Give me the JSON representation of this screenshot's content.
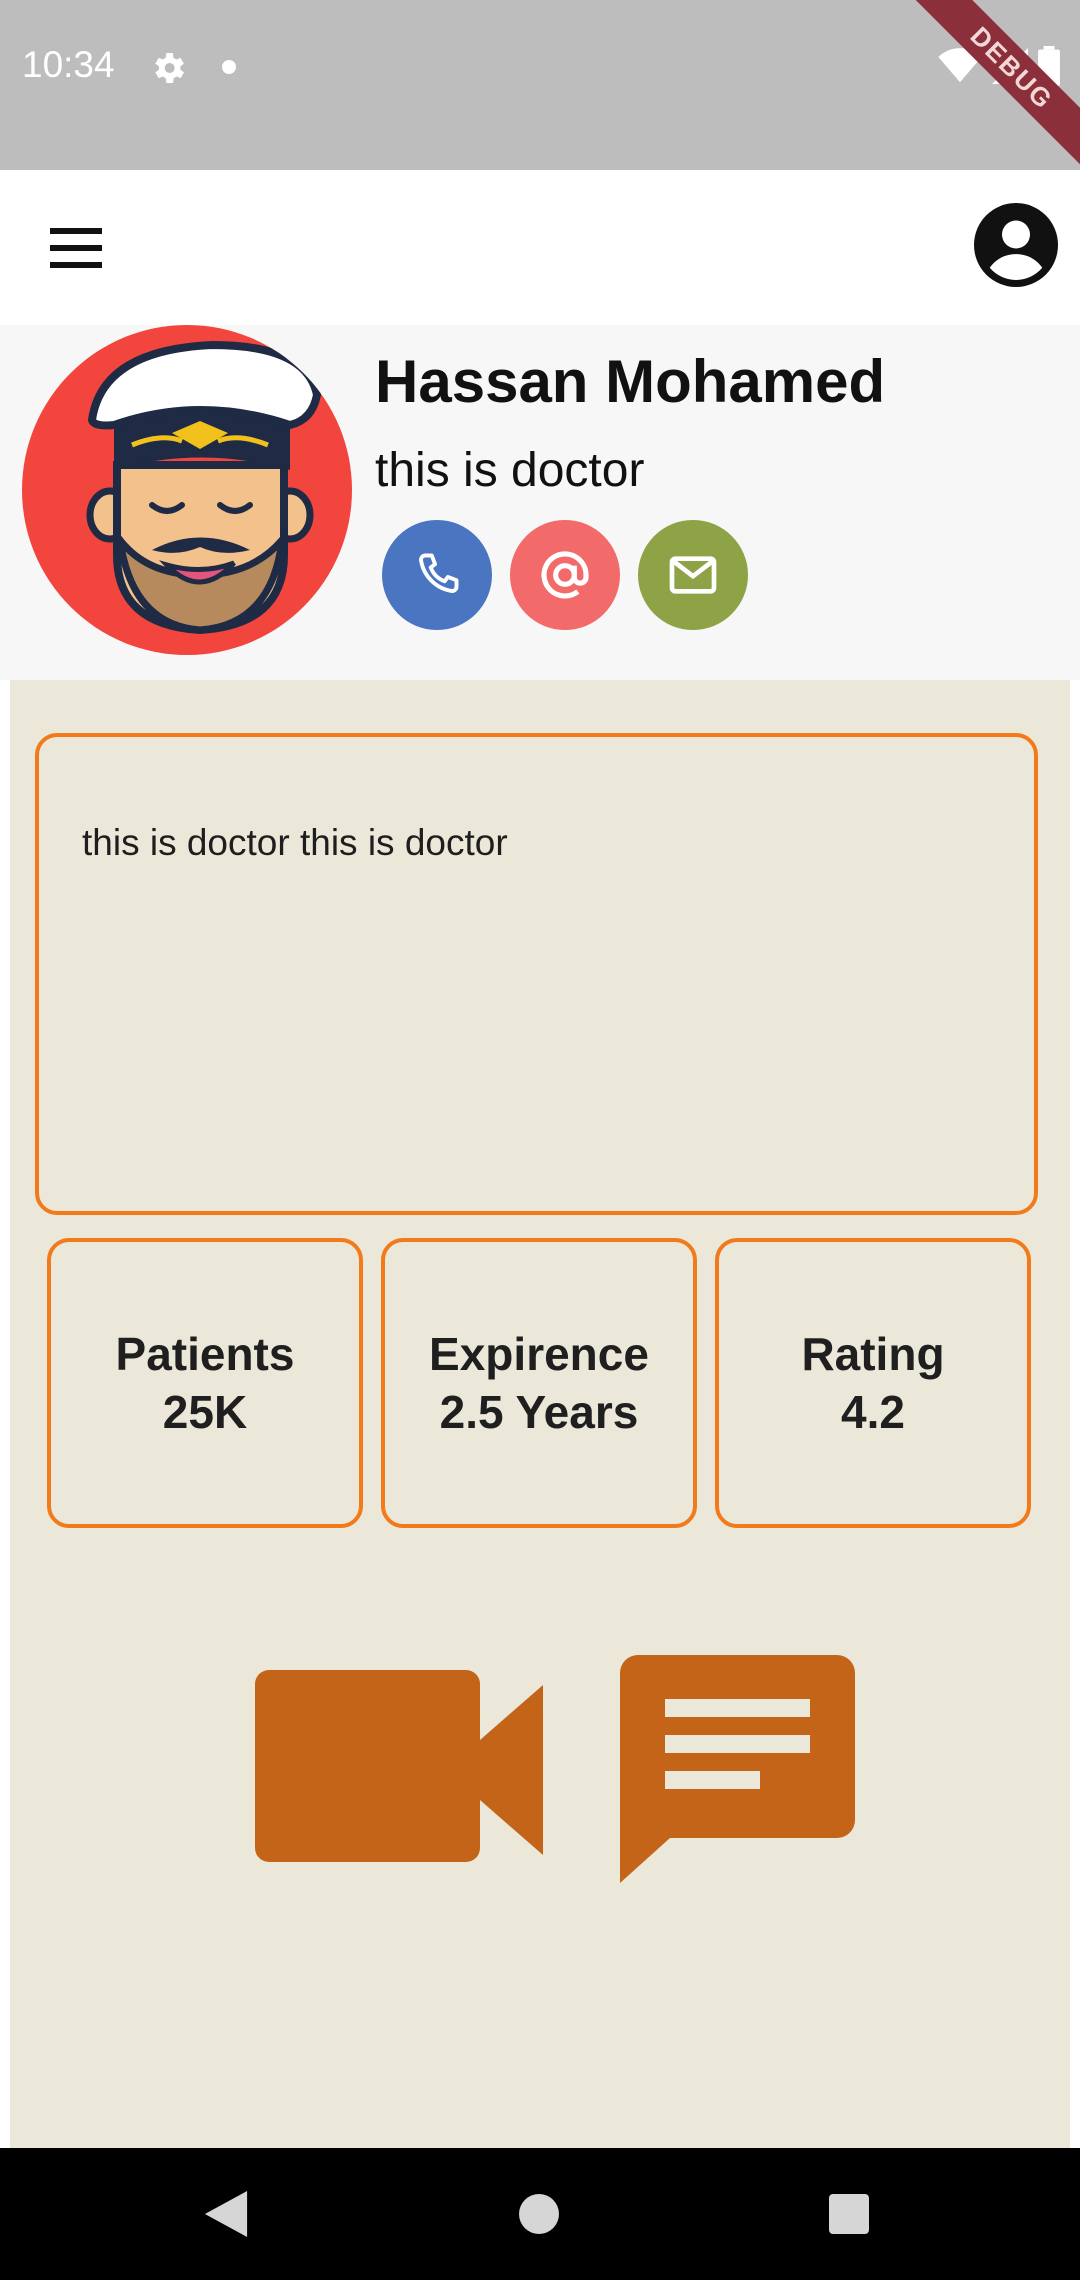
{
  "status_bar": {
    "time": "10:34",
    "icons": [
      "gear-icon",
      "notification-dot-icon",
      "wifi-icon",
      "signal-icon",
      "battery-icon"
    ],
    "debug_banner": "DEBUG"
  },
  "app_bar": {
    "icons": [
      "menu-icon",
      "account-icon"
    ]
  },
  "profile": {
    "name": "Hassan Mohamed",
    "subtitle": "this is doctor",
    "contact_buttons": [
      {
        "icon": "phone-icon",
        "color": "#4a76c1"
      },
      {
        "icon": "at-sign-icon",
        "color": "#f26a6a"
      },
      {
        "icon": "mail-icon",
        "color": "#8ea345"
      }
    ]
  },
  "about": {
    "text": "this is doctor this is doctor"
  },
  "stats": [
    {
      "label": "Patients",
      "value": "25K"
    },
    {
      "label": "Expirence",
      "value": "2.5 Years"
    },
    {
      "label": "Rating",
      "value": "4.2"
    }
  ],
  "actions": {
    "icons": [
      "video-call-icon",
      "chat-icon"
    ],
    "color": "#c46418"
  },
  "colors": {
    "accent_border": "#f27a1a",
    "content_background": "#ebe8da",
    "avatar_background": "#f2453d"
  }
}
